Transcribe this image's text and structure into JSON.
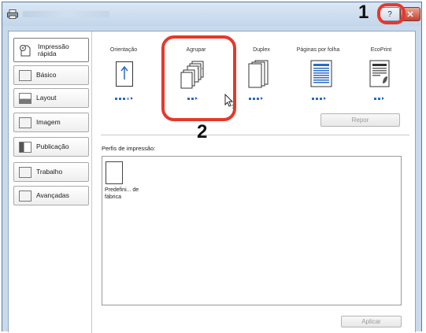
{
  "window": {
    "title": ""
  },
  "sidebar": {
    "items": [
      {
        "label": "Impressão rápida",
        "icon": "quick-print-icon",
        "active": true
      },
      {
        "label": "Básico",
        "icon": "basic-page-icon"
      },
      {
        "label": "Layout",
        "icon": "layout-icon"
      },
      {
        "label": "Imagem",
        "icon": "image-settings-icon"
      },
      {
        "label": "Publicação",
        "icon": "publishing-icon"
      },
      {
        "label": "Trabalho",
        "icon": "job-icon"
      },
      {
        "label": "Avançadas",
        "icon": "advanced-icon"
      }
    ]
  },
  "quick_print": {
    "columns": [
      {
        "label": "Orientação",
        "icon": "orientation-icon"
      },
      {
        "label": "Agrupar",
        "icon": "collate-icon"
      },
      {
        "label": "Duplex",
        "icon": "duplex-icon"
      },
      {
        "label": "Páginas por folha",
        "icon": "pages-per-sheet-icon"
      },
      {
        "label": "EcoPrint",
        "icon": "ecoprint-icon"
      }
    ],
    "reset_label": "Repor"
  },
  "profiles": {
    "label": "Perfis de impressão:",
    "items": [
      {
        "name": "Predefini... de fábrica"
      }
    ]
  },
  "apply_label": "Aplicar",
  "callouts": {
    "one": "1",
    "two": "2",
    "ring_color": "#e5392b"
  }
}
